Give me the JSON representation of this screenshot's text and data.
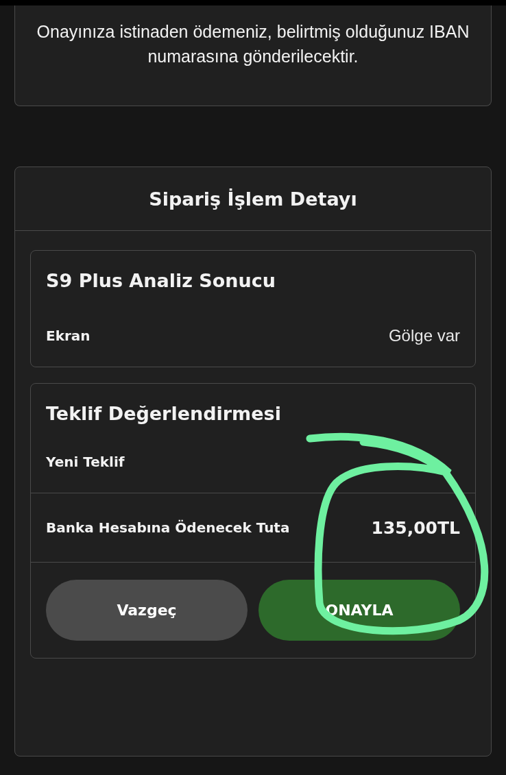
{
  "notice": {
    "text": "Onayınıza istinaden ödemeniz, belirtmiş olduğunuz IBAN numarasına gönderilecektir."
  },
  "details": {
    "title": "Sipariş İşlem Detayı",
    "analysis": {
      "title": "S9 Plus Analiz Sonucu",
      "rows": [
        {
          "label": "Ekran",
          "value": "Gölge var"
        }
      ]
    },
    "offer": {
      "title": "Teklif Değerlendirmesi",
      "rows": [
        {
          "label": "Yeni Teklif"
        },
        {
          "label": "Banka Hesabına Ödenecek Tuta",
          "value": "135,00TL"
        }
      ],
      "buttons": [
        {
          "label": "Vazgeç",
          "kind": "cancel"
        },
        {
          "label": "ONAYLA",
          "kind": "confirm"
        }
      ]
    }
  },
  "annotation": {
    "kind": "circle",
    "color": "#6ef0a0"
  }
}
